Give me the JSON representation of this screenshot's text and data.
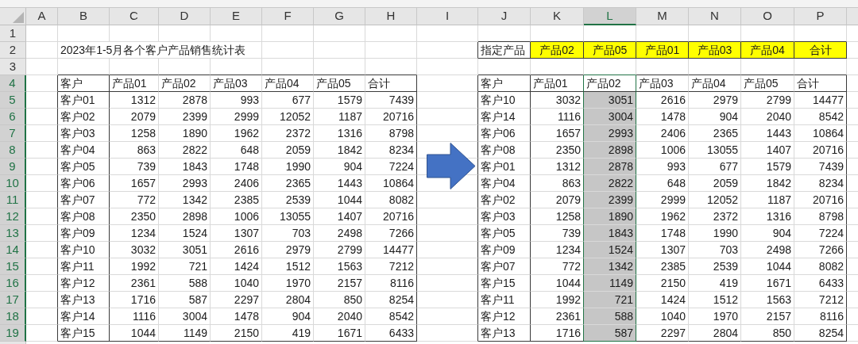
{
  "columns": [
    {
      "label": "A",
      "selected": false
    },
    {
      "label": "B",
      "selected": false
    },
    {
      "label": "C",
      "selected": false
    },
    {
      "label": "D",
      "selected": false
    },
    {
      "label": "E",
      "selected": false
    },
    {
      "label": "F",
      "selected": false
    },
    {
      "label": "G",
      "selected": false
    },
    {
      "label": "H",
      "selected": false
    },
    {
      "label": "I",
      "selected": false
    },
    {
      "label": "J",
      "selected": false
    },
    {
      "label": "K",
      "selected": false
    },
    {
      "label": "L",
      "selected": true
    },
    {
      "label": "M",
      "selected": false
    },
    {
      "label": "N",
      "selected": false
    },
    {
      "label": "O",
      "selected": false
    },
    {
      "label": "P",
      "selected": false
    }
  ],
  "rows": [
    {
      "label": "1",
      "selected": false
    },
    {
      "label": "2",
      "selected": false
    },
    {
      "label": "3",
      "selected": false
    },
    {
      "label": "4",
      "selected": true
    },
    {
      "label": "5",
      "selected": true
    },
    {
      "label": "6",
      "selected": true
    },
    {
      "label": "7",
      "selected": true
    },
    {
      "label": "8",
      "selected": true
    },
    {
      "label": "9",
      "selected": true
    },
    {
      "label": "10",
      "selected": true
    },
    {
      "label": "11",
      "selected": true
    },
    {
      "label": "12",
      "selected": true
    },
    {
      "label": "13",
      "selected": true
    },
    {
      "label": "14",
      "selected": true
    },
    {
      "label": "15",
      "selected": true
    },
    {
      "label": "16",
      "selected": true
    },
    {
      "label": "17",
      "selected": true
    },
    {
      "label": "18",
      "selected": true
    },
    {
      "label": "19",
      "selected": true
    }
  ],
  "title": "2023年1-5月各个客户产品销售统计表",
  "picker": {
    "label": "指定产品",
    "options": [
      "产品02",
      "产品05",
      "产品01",
      "产品03",
      "产品04",
      "合计"
    ]
  },
  "left_table": {
    "columns": [
      "客户",
      "产品01",
      "产品02",
      "产品03",
      "产品04",
      "产品05",
      "合计"
    ],
    "rows": [
      [
        "客户01",
        "1312",
        "2878",
        "993",
        "677",
        "1579",
        "7439"
      ],
      [
        "客户02",
        "2079",
        "2399",
        "2999",
        "12052",
        "1187",
        "20716"
      ],
      [
        "客户03",
        "1258",
        "1890",
        "1962",
        "2372",
        "1316",
        "8798"
      ],
      [
        "客户04",
        "863",
        "2822",
        "648",
        "2059",
        "1842",
        "8234"
      ],
      [
        "客户05",
        "739",
        "1843",
        "1748",
        "1990",
        "904",
        "7224"
      ],
      [
        "客户06",
        "1657",
        "2993",
        "2406",
        "2365",
        "1443",
        "10864"
      ],
      [
        "客户07",
        "772",
        "1342",
        "2385",
        "2539",
        "1044",
        "8082"
      ],
      [
        "客户08",
        "2350",
        "2898",
        "1006",
        "13055",
        "1407",
        "20716"
      ],
      [
        "客户09",
        "1234",
        "1524",
        "1307",
        "703",
        "2498",
        "7266"
      ],
      [
        "客户10",
        "3032",
        "3051",
        "2616",
        "2979",
        "2799",
        "14477"
      ],
      [
        "客户11",
        "1992",
        "721",
        "1424",
        "1512",
        "1563",
        "7212"
      ],
      [
        "客户12",
        "2361",
        "588",
        "1040",
        "1970",
        "2157",
        "8116"
      ],
      [
        "客户13",
        "1716",
        "587",
        "2297",
        "2804",
        "850",
        "8254"
      ],
      [
        "客户14",
        "1116",
        "3004",
        "1478",
        "904",
        "2040",
        "8542"
      ],
      [
        "客户15",
        "1044",
        "1149",
        "2150",
        "419",
        "1671",
        "6433"
      ]
    ]
  },
  "right_table": {
    "columns": [
      {
        "label": "客户",
        "selected": false
      },
      {
        "label": "产品01",
        "selected": false
      },
      {
        "label": "产品02",
        "selected": true
      },
      {
        "label": "产品03",
        "selected": false
      },
      {
        "label": "产品04",
        "selected": false
      },
      {
        "label": "产品05",
        "selected": false
      },
      {
        "label": "合计",
        "selected": false
      }
    ],
    "rows": [
      [
        "客户10",
        "3032",
        "3051",
        "2616",
        "2979",
        "2799",
        "14477"
      ],
      [
        "客户14",
        "1116",
        "3004",
        "1478",
        "904",
        "2040",
        "8542"
      ],
      [
        "客户06",
        "1657",
        "2993",
        "2406",
        "2365",
        "1443",
        "10864"
      ],
      [
        "客户08",
        "2350",
        "2898",
        "1006",
        "13055",
        "1407",
        "20716"
      ],
      [
        "客户01",
        "1312",
        "2878",
        "993",
        "677",
        "1579",
        "7439"
      ],
      [
        "客户04",
        "863",
        "2822",
        "648",
        "2059",
        "1842",
        "8234"
      ],
      [
        "客户02",
        "2079",
        "2399",
        "2999",
        "12052",
        "1187",
        "20716"
      ],
      [
        "客户03",
        "1258",
        "1890",
        "1962",
        "2372",
        "1316",
        "8798"
      ],
      [
        "客户05",
        "739",
        "1843",
        "1748",
        "1990",
        "904",
        "7224"
      ],
      [
        "客户09",
        "1234",
        "1524",
        "1307",
        "703",
        "2498",
        "7266"
      ],
      [
        "客户07",
        "772",
        "1342",
        "2385",
        "2539",
        "1044",
        "8082"
      ],
      [
        "客户15",
        "1044",
        "1149",
        "2150",
        "419",
        "1671",
        "6433"
      ],
      [
        "客户11",
        "1992",
        "721",
        "1424",
        "1512",
        "1563",
        "7212"
      ],
      [
        "客户12",
        "2361",
        "588",
        "1040",
        "1970",
        "2157",
        "8116"
      ],
      [
        "客户13",
        "1716",
        "587",
        "2297",
        "2804",
        "850",
        "8254"
      ]
    ]
  }
}
